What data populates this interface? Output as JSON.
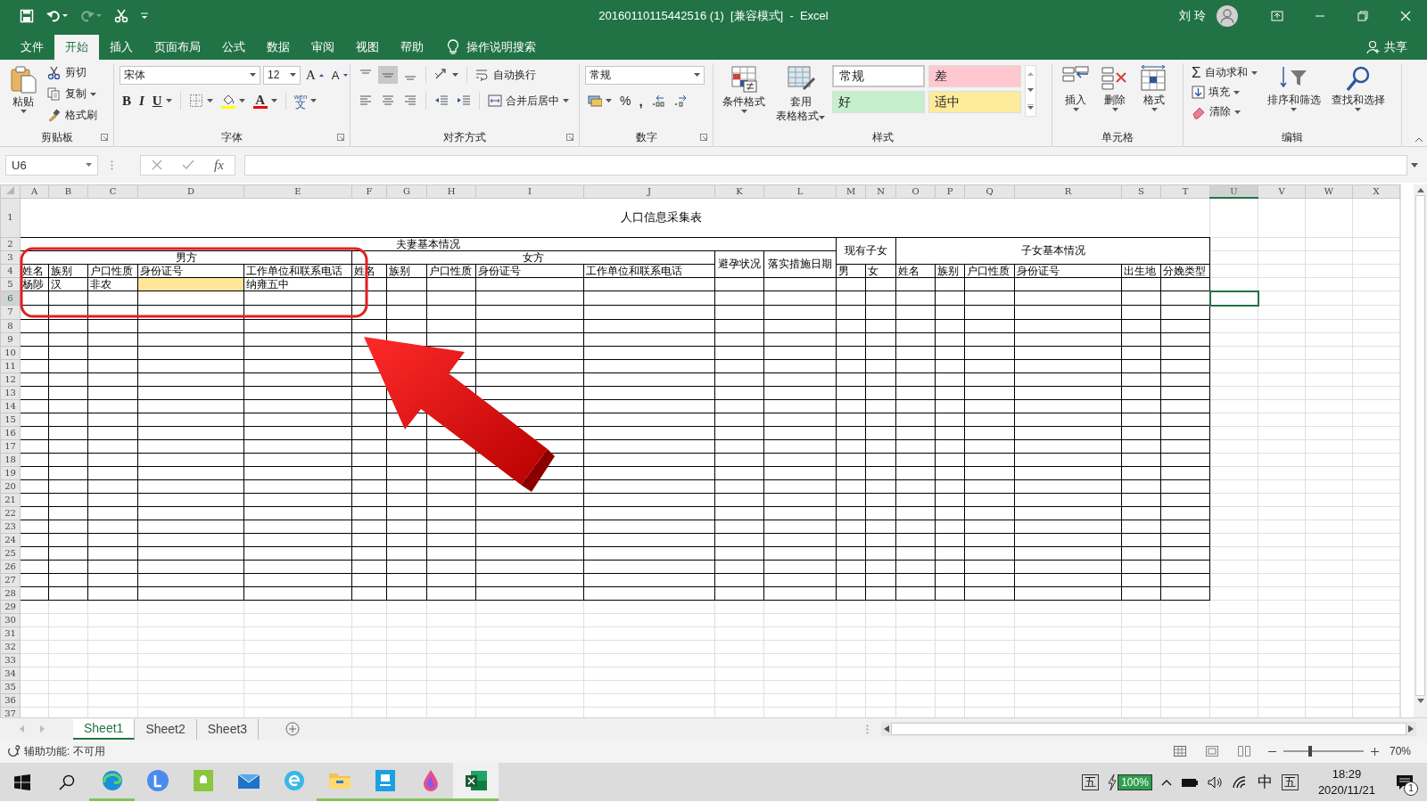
{
  "window": {
    "title": "20160110115442516 (1)  [兼容模式]  -  Excel",
    "user": "刘 玲"
  },
  "ribbon_tabs": [
    {
      "label": "文件",
      "selected": false
    },
    {
      "label": "开始",
      "selected": true
    },
    {
      "label": "插入",
      "selected": false
    },
    {
      "label": "页面布局",
      "selected": false
    },
    {
      "label": "公式",
      "selected": false
    },
    {
      "label": "数据",
      "selected": false
    },
    {
      "label": "审阅",
      "selected": false
    },
    {
      "label": "视图",
      "selected": false
    },
    {
      "label": "帮助",
      "selected": false
    }
  ],
  "tell_me": "操作说明搜索",
  "share": "共享",
  "ribbon": {
    "clipboard": {
      "title": "剪贴板",
      "paste": "粘贴",
      "cut": "剪切",
      "copy": "复制",
      "format_painter": "格式刷"
    },
    "font": {
      "title": "字体",
      "font_name": "宋体",
      "font_size": "12",
      "grow": "A",
      "shrink": "A",
      "bold": "B",
      "italic": "I",
      "underline": "U",
      "font_color": "A",
      "phonetic_top": "wén",
      "phonetic": "文"
    },
    "alignment": {
      "title": "对齐方式",
      "wrap_text": "自动换行",
      "merge_center": "合并后居中"
    },
    "number": {
      "title": "数字",
      "format": "常规",
      "percent": "%",
      "comma": ","
    },
    "styles": {
      "title": "样式",
      "conditional": "条件格式",
      "table_format_1": "套用",
      "table_format_2": "表格格式",
      "cell_styles": [
        {
          "label": "常规",
          "color": "#ffffff"
        },
        {
          "label": "差",
          "color": "#ffc7ce"
        },
        {
          "label": "好",
          "color": "#c6efce"
        },
        {
          "label": "适中",
          "color": "#ffeb9c"
        }
      ]
    },
    "cells": {
      "title": "单元格",
      "buttons": [
        {
          "label": "插入",
          "kind": "insert"
        },
        {
          "label": "删除",
          "kind": "delete"
        },
        {
          "label": "格式",
          "kind": "format"
        }
      ]
    },
    "editing": {
      "title": "编辑",
      "sum_symbol": "Σ",
      "autosum": "自动求和",
      "fill": "填充",
      "clear": "清除",
      "sort": "排序和筛选",
      "find": "查找和选择"
    }
  },
  "formula_bar": {
    "name_box": "U6",
    "fx": "fx"
  },
  "sheet": {
    "columns": [
      {
        "label": "A",
        "selected": false
      },
      {
        "label": "B",
        "selected": false
      },
      {
        "label": "C",
        "selected": false
      },
      {
        "label": "D",
        "selected": false
      },
      {
        "label": "E",
        "selected": false
      },
      {
        "label": "F",
        "selected": false
      },
      {
        "label": "G",
        "selected": false
      },
      {
        "label": "H",
        "selected": false
      },
      {
        "label": "I",
        "selected": false
      },
      {
        "label": "J",
        "selected": false
      },
      {
        "label": "K",
        "selected": false
      },
      {
        "label": "L",
        "selected": false
      },
      {
        "label": "M",
        "selected": false
      },
      {
        "label": "N",
        "selected": false
      },
      {
        "label": "O",
        "selected": false
      },
      {
        "label": "P",
        "selected": false
      },
      {
        "label": "Q",
        "selected": false
      },
      {
        "label": "R",
        "selected": false
      },
      {
        "label": "S",
        "selected": false
      },
      {
        "label": "T",
        "selected": false
      },
      {
        "label": "U",
        "selected": true
      },
      {
        "label": "V",
        "selected": false
      },
      {
        "label": "W",
        "selected": false
      },
      {
        "label": "X",
        "selected": false
      }
    ],
    "rows": [
      {
        "label": "1",
        "selected": false
      },
      {
        "label": "2",
        "selected": false
      },
      {
        "label": "3",
        "selected": false
      },
      {
        "label": "4",
        "selected": false
      },
      {
        "label": "5",
        "selected": false
      },
      {
        "label": "6",
        "selected": true
      },
      {
        "label": "7",
        "selected": false
      },
      {
        "label": "8",
        "selected": false
      },
      {
        "label": "9",
        "selected": false
      },
      {
        "label": "10",
        "selected": false
      },
      {
        "label": "11",
        "selected": false
      },
      {
        "label": "12",
        "selected": false
      },
      {
        "label": "13",
        "selected": false
      },
      {
        "label": "14",
        "selected": false
      },
      {
        "label": "15",
        "selected": false
      },
      {
        "label": "16",
        "selected": false
      },
      {
        "label": "17",
        "selected": false
      },
      {
        "label": "18",
        "selected": false
      },
      {
        "label": "19",
        "selected": false
      },
      {
        "label": "20",
        "selected": false
      },
      {
        "label": "21",
        "selected": false
      },
      {
        "label": "22",
        "selected": false
      },
      {
        "label": "23",
        "selected": false
      },
      {
        "label": "24",
        "selected": false
      },
      {
        "label": "25",
        "selected": false
      },
      {
        "label": "26",
        "selected": false
      },
      {
        "label": "27",
        "selected": false
      },
      {
        "label": "28",
        "selected": false
      },
      {
        "label": "29",
        "selected": false
      },
      {
        "label": "30",
        "selected": false
      },
      {
        "label": "31",
        "selected": false
      },
      {
        "label": "32",
        "selected": false
      },
      {
        "label": "33",
        "selected": false
      },
      {
        "label": "34",
        "selected": false
      },
      {
        "label": "35",
        "selected": false
      },
      {
        "label": "36",
        "selected": false
      },
      {
        "label": "37",
        "selected": false
      }
    ]
  },
  "table": {
    "title": "人口信息采集表",
    "group_couple": "夫妻基本情况",
    "group_children_now": "现有子女",
    "group_children": "子女基本情况",
    "group_male": "男方",
    "group_female": "女方",
    "contraception": "避孕状况",
    "measure_date": "落实措施日期",
    "headers": [
      "姓名",
      "族别",
      "户口性质",
      "身份证号",
      "工作单位和联系电话",
      "姓名",
      "族别",
      "户口性质",
      "身份证号",
      "工作单位和联系电话",
      "男",
      "女",
      "姓名",
      "族别",
      "户口性质",
      "身份证号",
      "出生地",
      "分娩类型"
    ],
    "records": [
      {
        "name": "杨陟",
        "ethnicity": "汉",
        "household": "非农",
        "id_highlighted": true,
        "workplace": "纳雍五中"
      }
    ]
  },
  "annotations": {
    "highlight_box": true,
    "arrow": true
  },
  "sheet_tabs": [
    {
      "label": "Sheet1",
      "selected": true
    },
    {
      "label": "Sheet2",
      "selected": false
    },
    {
      "label": "Sheet3",
      "selected": false
    }
  ],
  "status_bar": {
    "accessibility": "辅助功能: 不可用",
    "zoom": {
      "level": 0.31,
      "reading": "70%"
    }
  },
  "taskbar": {
    "apps": [
      {
        "kind": "edge",
        "running": true,
        "active": false
      },
      {
        "kind": "circle",
        "running": false,
        "active": false
      },
      {
        "kind": "chat",
        "running": false,
        "active": false
      },
      {
        "kind": "mail",
        "running": false,
        "active": false
      },
      {
        "kind": "ebrowser",
        "running": false,
        "active": false
      },
      {
        "kind": "folder",
        "running": true,
        "active": false
      },
      {
        "kind": "board",
        "running": true,
        "active": false
      },
      {
        "kind": "paint",
        "running": true,
        "active": false
      },
      {
        "kind": "excel",
        "running": true,
        "active": true
      }
    ],
    "ime_mode": "五",
    "battery": "100%",
    "input_lang": "中",
    "ime": "五",
    "time": "18:29",
    "date": "2020/11/21",
    "notifications": "1"
  }
}
